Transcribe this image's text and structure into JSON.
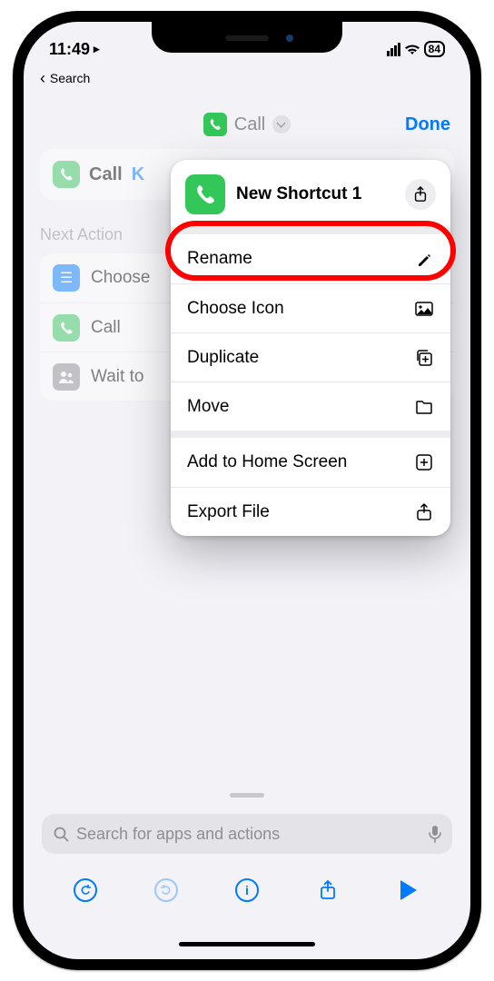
{
  "status": {
    "time": "11:49",
    "battery": "84"
  },
  "back_label": "Search",
  "nav": {
    "title": "Call",
    "done": "Done"
  },
  "call_card": {
    "label": "Call",
    "contact_fragment": "K"
  },
  "next_action_heading": "Next Action",
  "suggestions": {
    "choose": "Choose",
    "call": "Call",
    "wait": "Wait to"
  },
  "popover": {
    "title": "New Shortcut 1",
    "rename": "Rename",
    "choose_icon": "Choose Icon",
    "duplicate": "Duplicate",
    "move": "Move",
    "add_home": "Add to Home Screen",
    "export": "Export File"
  },
  "search_placeholder": "Search for apps and actions",
  "colors": {
    "accent": "#007aff",
    "green": "#33c759",
    "grey": "#8e8e93"
  }
}
